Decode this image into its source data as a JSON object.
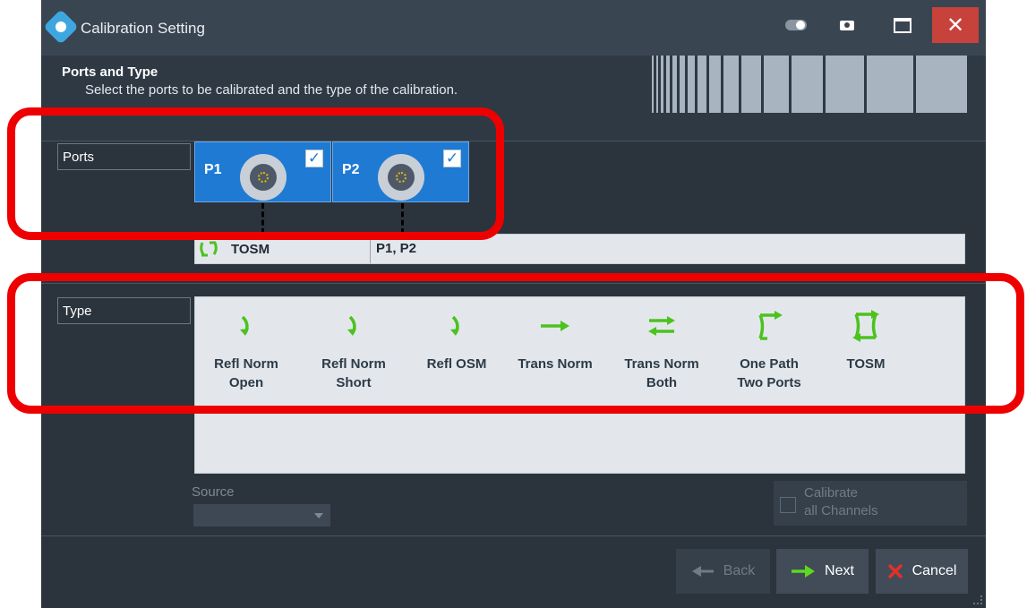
{
  "window": {
    "title": "Calibration Setting",
    "accent_color": "#1f7ad3",
    "highlight_color": "#ee0000",
    "titlebar_buttons": [
      {
        "icon": "toggle-icon"
      },
      {
        "icon": "camera-icon"
      },
      {
        "icon": "maximize-icon"
      },
      {
        "icon": "close-icon",
        "label": "✕"
      }
    ]
  },
  "header": {
    "title": "Ports and Type",
    "subtitle": "Select the ports to be calibrated and the type of the calibration."
  },
  "ports": {
    "label": "Ports",
    "items": [
      {
        "name": "P1",
        "checked": true,
        "check_mark": "✓"
      },
      {
        "name": "P2",
        "checked": true,
        "check_mark": "✓"
      }
    ]
  },
  "calibration": {
    "type": "TOSM",
    "ports": "P1, P2"
  },
  "type_section": {
    "label": "Type",
    "items": [
      {
        "label": "Refl Norm\nOpen",
        "icon": "reflection-arrow-icon"
      },
      {
        "label": "Refl Norm\nShort",
        "icon": "reflection-arrow-icon"
      },
      {
        "label": "Refl OSM",
        "icon": "reflection-arrow-icon"
      },
      {
        "label": "Trans Norm",
        "icon": "right-arrow-icon"
      },
      {
        "label": "Trans Norm\nBoth",
        "icon": "bidirectional-arrows-icon"
      },
      {
        "label": "One Path\nTwo Ports",
        "icon": "one-path-arrow-icon"
      },
      {
        "label": "TOSM",
        "icon": "tosm-loop-icon"
      }
    ]
  },
  "source": {
    "label": "Source",
    "value": ""
  },
  "calibrate_all": {
    "label": "Calibrate\nall Channels",
    "checked": false,
    "enabled": false
  },
  "buttons": {
    "back": "Back",
    "next": "Next",
    "cancel": "Cancel"
  }
}
